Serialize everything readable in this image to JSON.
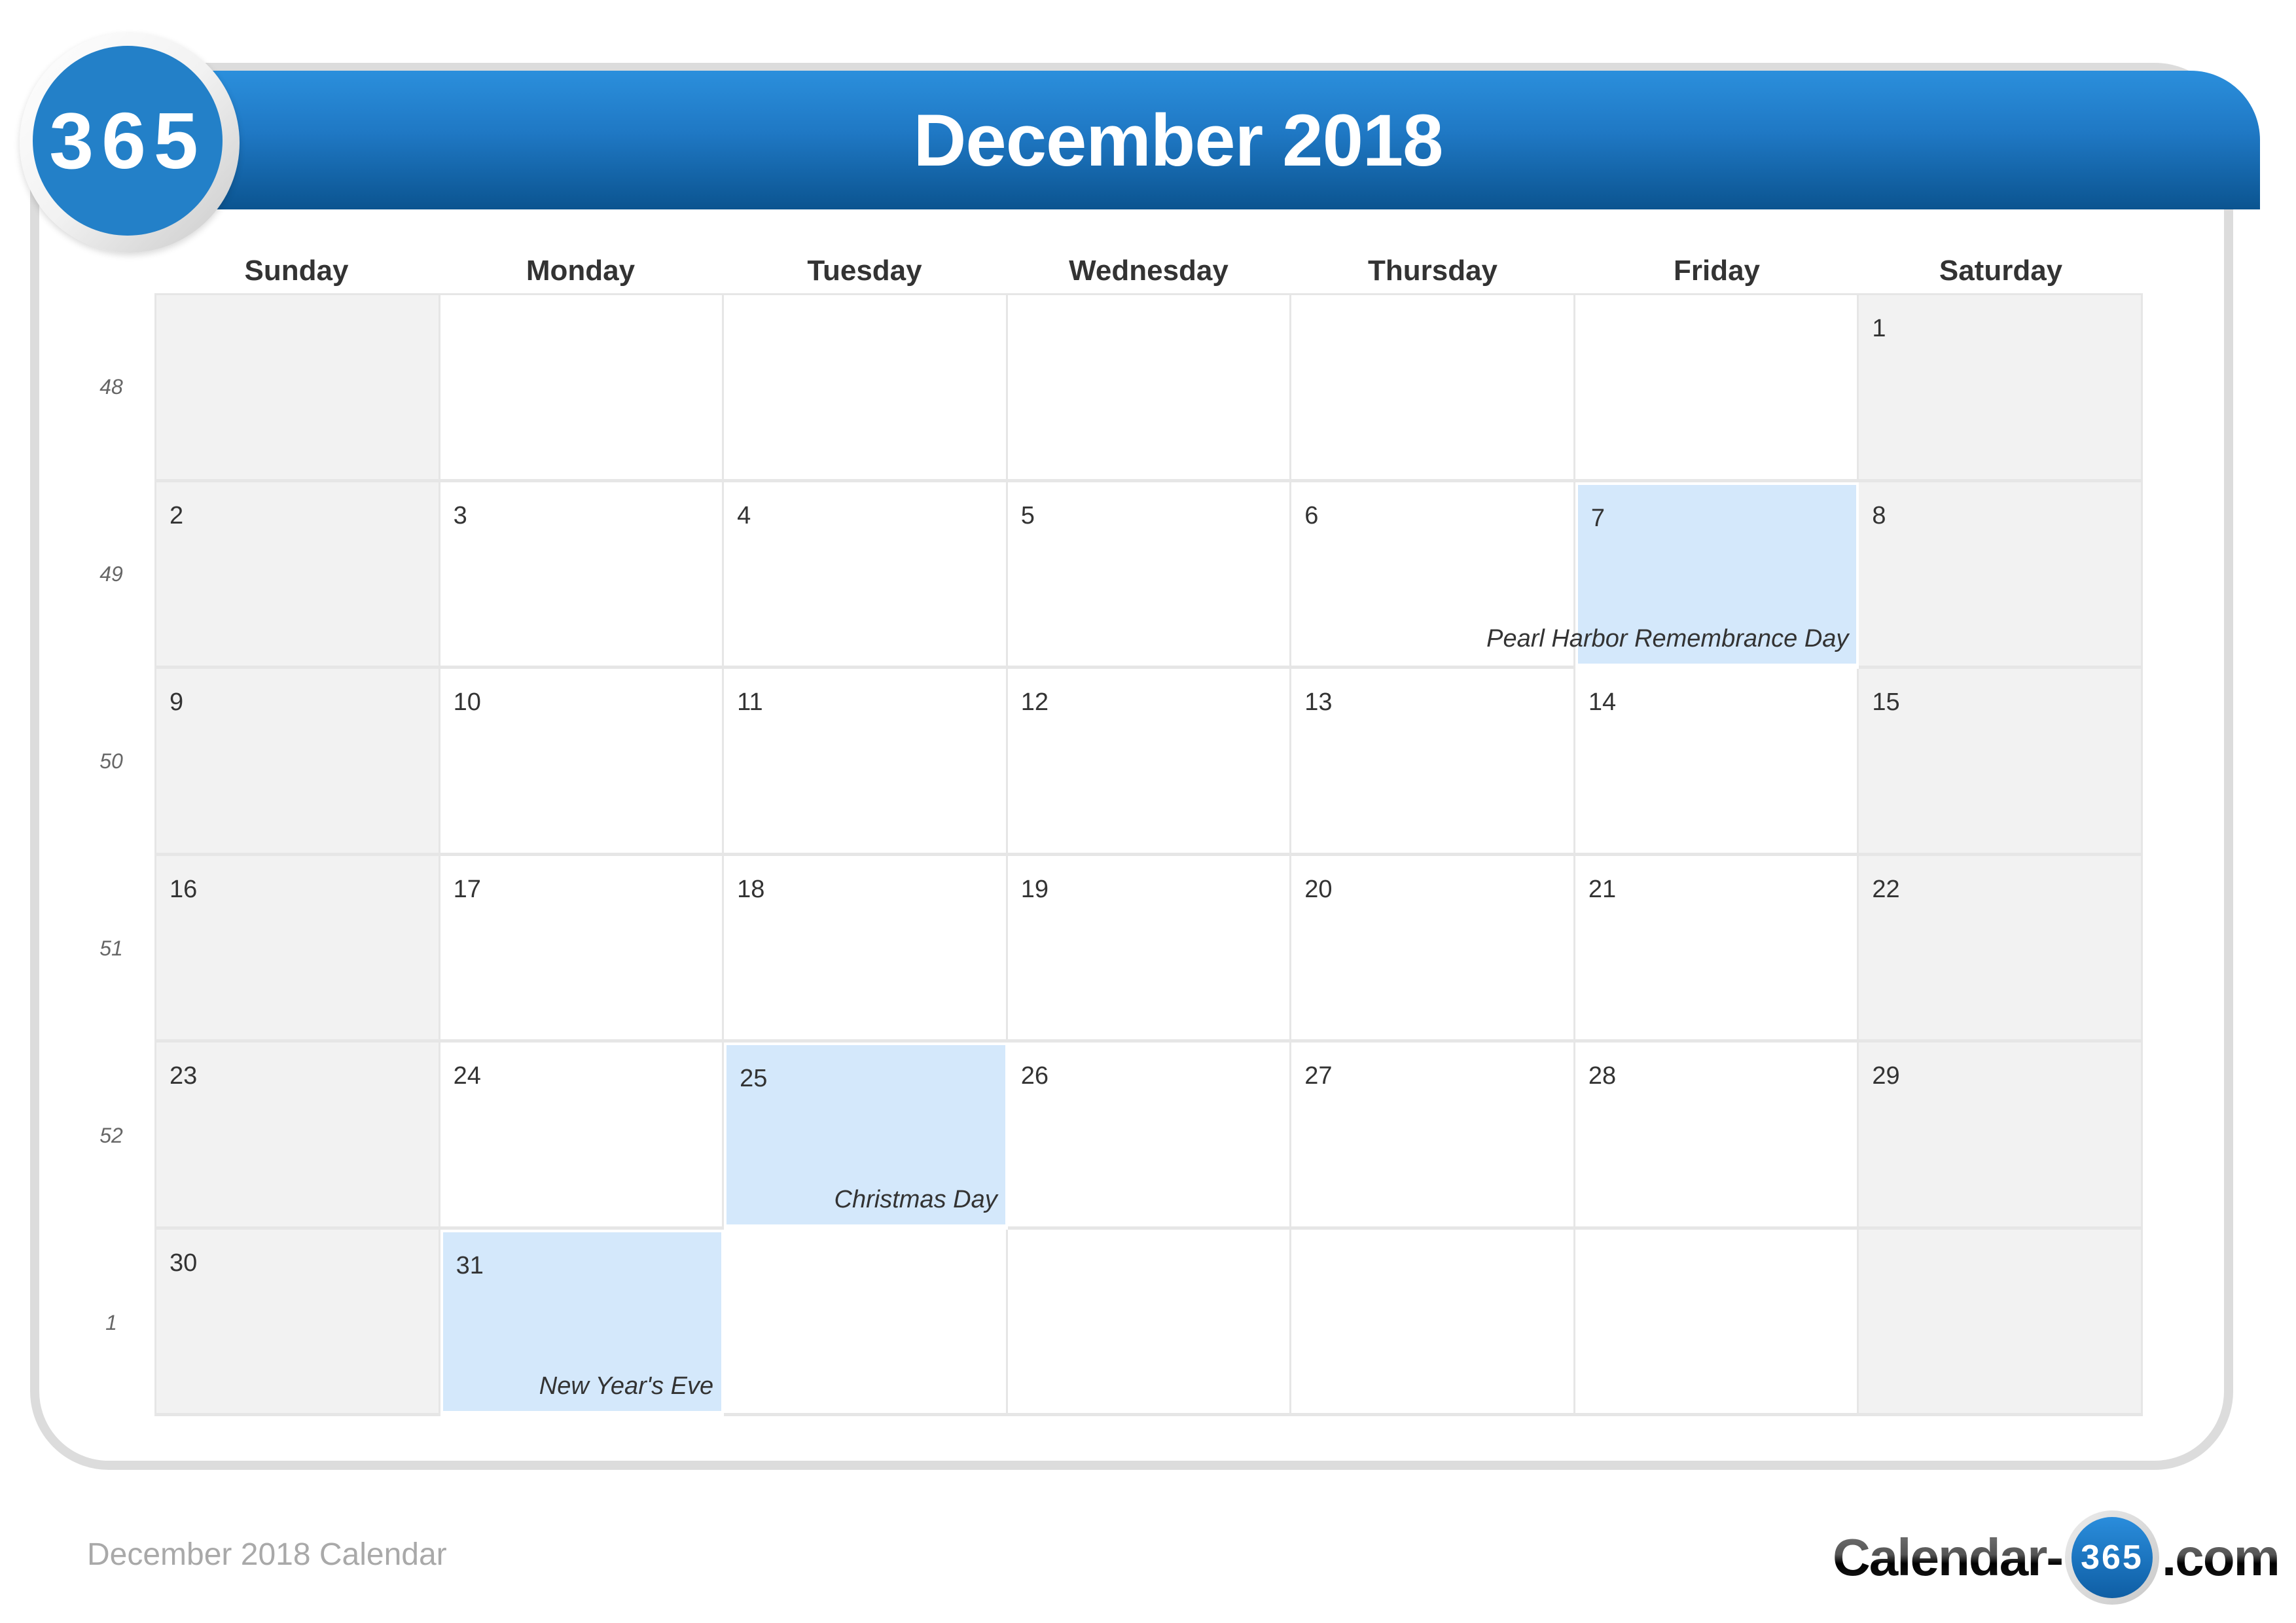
{
  "header": {
    "title": "December 2018",
    "logo_text": "365"
  },
  "colors": {
    "header_blue_top": "#2b8fdc",
    "header_blue_bottom": "#0b5490",
    "holiday_fill": "#d4e8fb",
    "weekend_fill": "#f2f2f2"
  },
  "weekdays": [
    "Sunday",
    "Monday",
    "Tuesday",
    "Wednesday",
    "Thursday",
    "Friday",
    "Saturday"
  ],
  "week_numbers": [
    "48",
    "49",
    "50",
    "51",
    "52",
    "1"
  ],
  "weeks": [
    [
      {
        "day": ""
      },
      {
        "day": ""
      },
      {
        "day": ""
      },
      {
        "day": ""
      },
      {
        "day": ""
      },
      {
        "day": ""
      },
      {
        "day": "1"
      }
    ],
    [
      {
        "day": "2"
      },
      {
        "day": "3"
      },
      {
        "day": "4"
      },
      {
        "day": "5"
      },
      {
        "day": "6"
      },
      {
        "day": "7",
        "holiday": "Pearl Harbor Remembrance Day"
      },
      {
        "day": "8"
      }
    ],
    [
      {
        "day": "9"
      },
      {
        "day": "10"
      },
      {
        "day": "11"
      },
      {
        "day": "12"
      },
      {
        "day": "13"
      },
      {
        "day": "14"
      },
      {
        "day": "15"
      }
    ],
    [
      {
        "day": "16"
      },
      {
        "day": "17"
      },
      {
        "day": "18"
      },
      {
        "day": "19"
      },
      {
        "day": "20"
      },
      {
        "day": "21"
      },
      {
        "day": "22"
      }
    ],
    [
      {
        "day": "23"
      },
      {
        "day": "24"
      },
      {
        "day": "25",
        "holiday": "Christmas Day"
      },
      {
        "day": "26"
      },
      {
        "day": "27"
      },
      {
        "day": "28"
      },
      {
        "day": "29"
      }
    ],
    [
      {
        "day": "30"
      },
      {
        "day": "31",
        "holiday": "New Year's Eve"
      },
      {
        "day": ""
      },
      {
        "day": ""
      },
      {
        "day": ""
      },
      {
        "day": ""
      },
      {
        "day": ""
      }
    ]
  ],
  "footer": {
    "caption": "December 2018 Calendar",
    "brand_prefix": "Calendar-",
    "brand_badge": "365",
    "brand_suffix": ".com"
  }
}
